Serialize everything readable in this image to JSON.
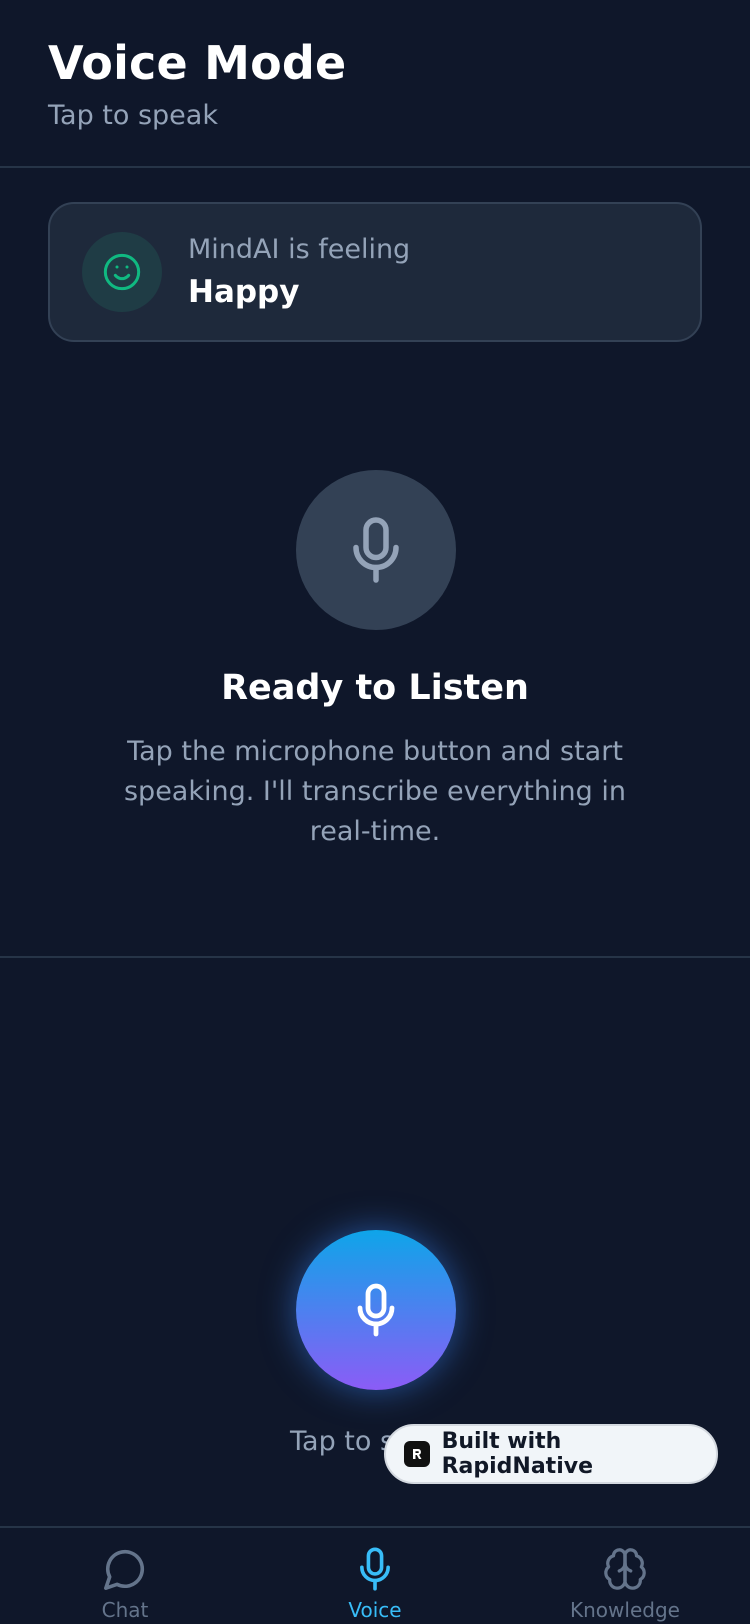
{
  "header": {
    "title": "Voice Mode",
    "subtitle": "Tap to speak"
  },
  "mood": {
    "label": "MindAI is feeling",
    "value": "Happy",
    "icon": "smile-icon",
    "accent": "#10b981"
  },
  "status": {
    "title": "Ready to Listen",
    "description": "Tap the microphone button and start speaking. I'll transcribe everything in real-time."
  },
  "record": {
    "hint": "Tap to speak",
    "gradient_top": "#0ea5e9",
    "gradient_bottom": "#8b5cf6"
  },
  "badge": {
    "text": "Built with RapidNative"
  },
  "tabs": [
    {
      "label": "Chat",
      "icon": "chat-bubble-icon",
      "active": false
    },
    {
      "label": "Voice",
      "icon": "microphone-icon",
      "active": true
    },
    {
      "label": "Knowledge",
      "icon": "brain-icon",
      "active": false
    }
  ],
  "colors": {
    "background": "#0f172a",
    "card": "#1e293b",
    "muted": "#94a3b8",
    "active_tab": "#38bdf8"
  }
}
